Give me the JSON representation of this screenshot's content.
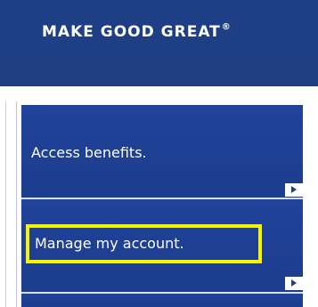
{
  "header": {
    "tagline": "MAKE GOOD GREAT",
    "trademark": "®"
  },
  "nav": {
    "items": [
      {
        "label": "Access benefits.",
        "arrow_icon": "play-arrow-icon"
      },
      {
        "label": "Manage my account.",
        "arrow_icon": "play-arrow-icon",
        "highlighted": true
      }
    ]
  },
  "colors": {
    "brand_navy": "#1e3f86",
    "nav_item_bg": "#20429a",
    "highlight": "#f6f200",
    "divider": "#d8dfee"
  }
}
